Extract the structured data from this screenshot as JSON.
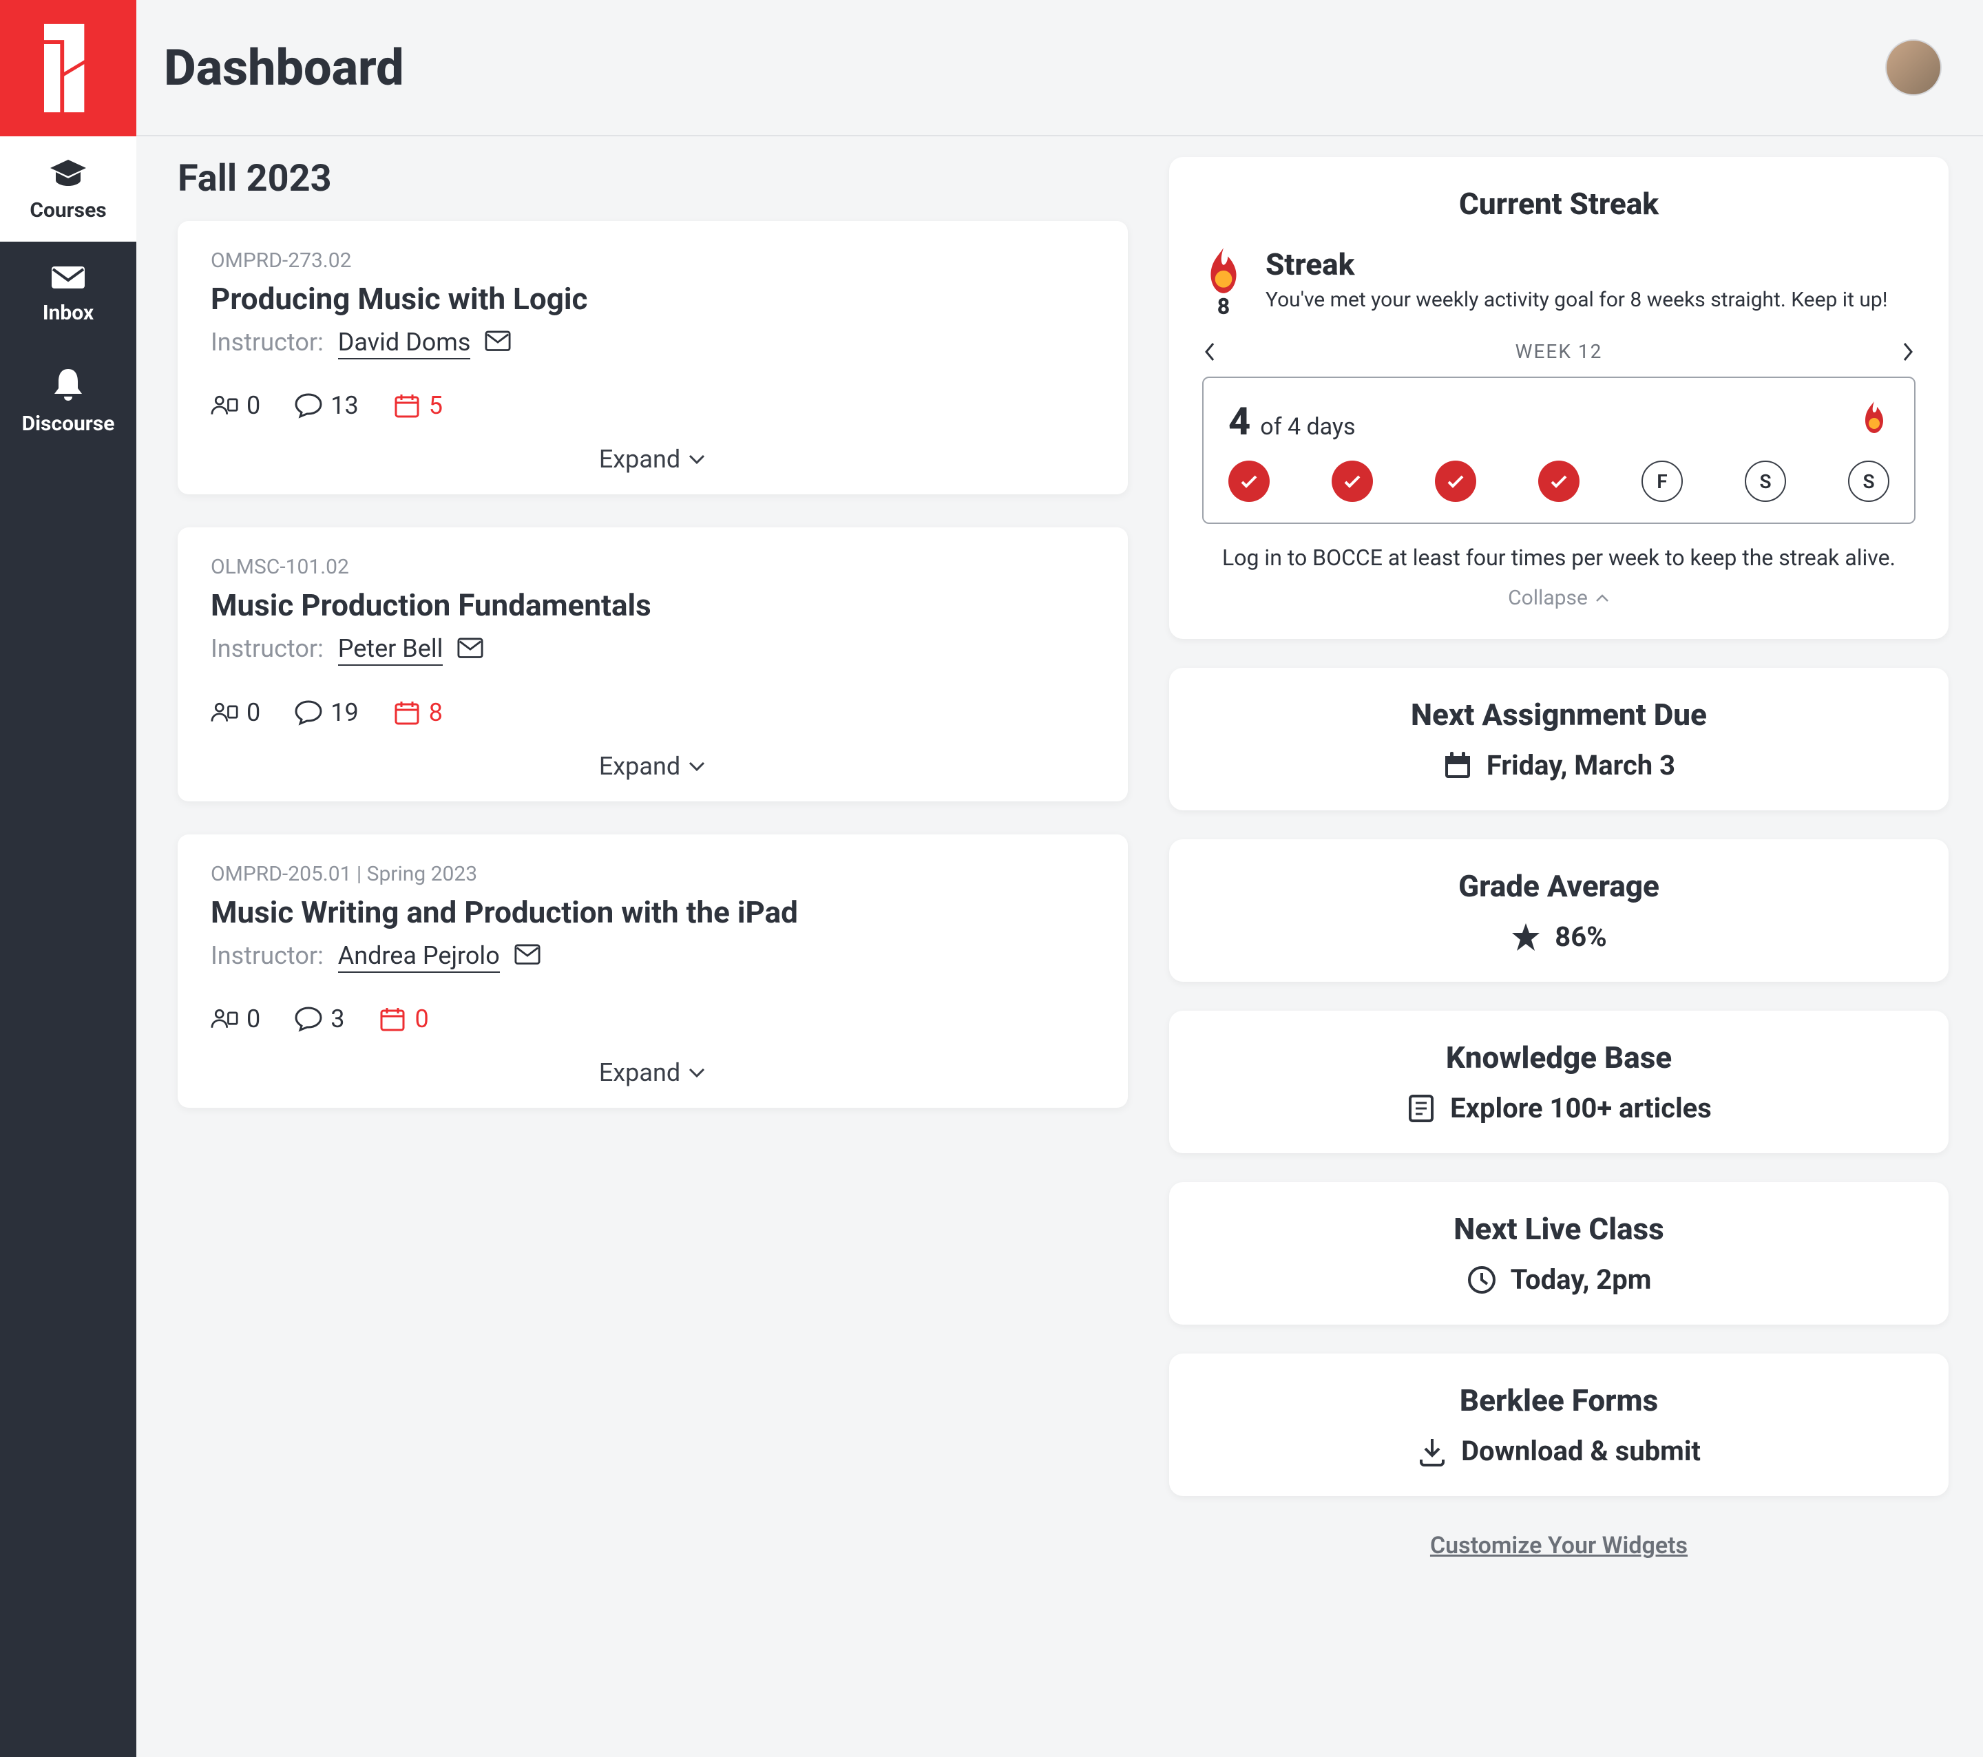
{
  "header": {
    "title": "Dashboard"
  },
  "nav": {
    "courses": "Courses",
    "inbox": "Inbox",
    "discourse": "Discourse"
  },
  "semester": "Fall 2023",
  "courses": [
    {
      "code": "OMPRD-273.02",
      "title": "Producing Music with Logic",
      "instructor_label": "Instructor:",
      "instructor": "David Doms",
      "stats": {
        "people": "0",
        "comments": "13",
        "calendar": "5"
      },
      "expand": "Expand"
    },
    {
      "code": "OLMSC-101.02",
      "title": "Music Production Fundamentals",
      "instructor_label": "Instructor:",
      "instructor": "Peter Bell",
      "stats": {
        "people": "0",
        "comments": "19",
        "calendar": "8"
      },
      "expand": "Expand"
    },
    {
      "code": "OMPRD-205.01 | Spring 2023",
      "title": "Music Writing and Production with the iPad",
      "instructor_label": "Instructor:",
      "instructor": "Andrea Pejrolo",
      "stats": {
        "people": "0",
        "comments": "3",
        "calendar": "0"
      },
      "expand": "Expand"
    }
  ],
  "streak": {
    "widget_title": "Current Streak",
    "title": "Streak",
    "sub": "You've met your weekly activity goal for 8 weeks straight. Keep it up!",
    "badge_num": "8",
    "week_label": "WEEK 12",
    "count": "4",
    "of_days": "of 4 days",
    "days": [
      {
        "done": true,
        "label": ""
      },
      {
        "done": true,
        "label": ""
      },
      {
        "done": true,
        "label": ""
      },
      {
        "done": true,
        "label": ""
      },
      {
        "done": false,
        "label": "F"
      },
      {
        "done": false,
        "label": "S"
      },
      {
        "done": false,
        "label": "S"
      }
    ],
    "help": "Log in to BOCCE at least four times per week to keep the streak alive.",
    "collapse": "Collapse"
  },
  "widgets": {
    "next_assignment": {
      "title": "Next Assignment Due",
      "value": "Friday, March 3"
    },
    "grade_avg": {
      "title": "Grade Average",
      "value": "86%"
    },
    "knowledge": {
      "title": "Knowledge Base",
      "value": "Explore 100+ articles"
    },
    "next_live": {
      "title": "Next Live Class",
      "value": "Today, 2pm"
    },
    "forms": {
      "title": "Berklee Forms",
      "value": "Download & submit"
    }
  },
  "customize": "Customize Your Widgets"
}
